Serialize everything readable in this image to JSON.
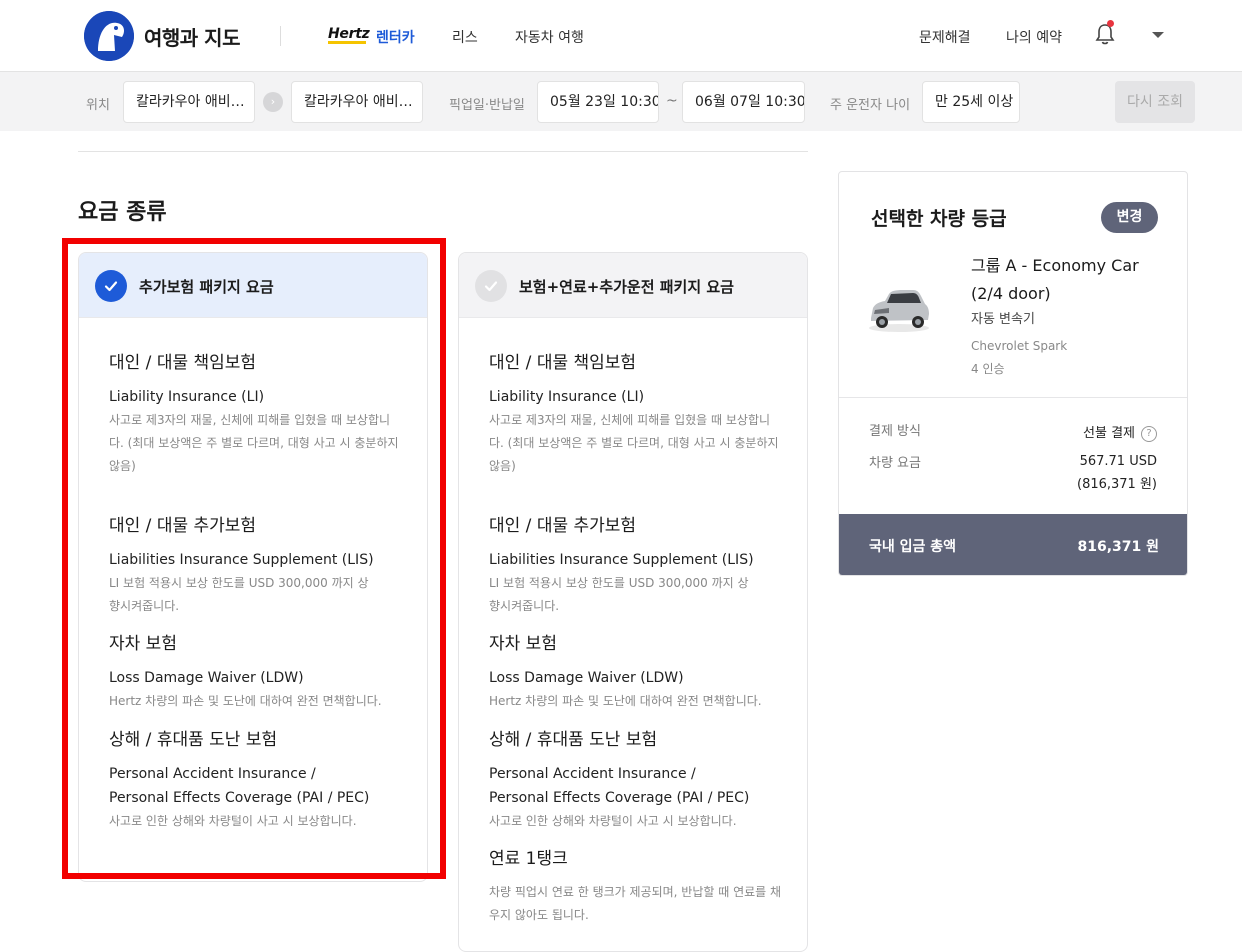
{
  "header": {
    "brand": "여행과 지도",
    "hertz_logo": "Hertz",
    "nav": [
      {
        "label": "렌터카",
        "active": true
      },
      {
        "label": "리스",
        "active": false
      },
      {
        "label": "자동차 여행",
        "active": false
      }
    ],
    "right_links": [
      "문제해결",
      "나의 예약"
    ],
    "icons": {
      "bell": "bell-icon",
      "menu": "chevron-down-icon"
    },
    "accent_color": "#1e5bd8"
  },
  "search": {
    "location_label": "위치",
    "pickup_location": "칼라카우아 애비…",
    "return_location": "칼라카우아 애비…",
    "dates_label": "픽업일·반납일",
    "pickup_date": "05월 23일 10:30",
    "tilde": "~",
    "return_date": "06월 07일 10:30",
    "driver_age_label": "주 운전자 나이",
    "driver_age": "만 25세 이상",
    "search_button": "다시 조회"
  },
  "rates": {
    "section_title": "요금 종류",
    "plans": [
      {
        "title": "추가보험 패키지 요금",
        "selected": true,
        "coverages": [
          {
            "heading": "대인 / 대물 책임보험",
            "english": "Liability Insurance (LI)",
            "desc": "사고로 제3자의 재물, 신체에 피해를 입혔을 때 보상합니다. (최대 보상액은 주 별로 다르며, 대형 사고 시 충분하지 않음)"
          },
          {
            "heading": "대인 / 대물 추가보험",
            "english": "Liabilities Insurance Supplement (LIS)",
            "desc": "LI 보험 적용시 보상 한도를 USD 300,000 까지 상향시켜줍니다."
          },
          {
            "heading": "자차 보험",
            "english": "Loss Damage Waiver (LDW)",
            "desc": "Hertz 차량의 파손 및 도난에 대하여 완전 면책합니다."
          },
          {
            "heading": "상해 / 휴대품 도난 보험",
            "english": "Personal Accident Insurance / Personal Effects Coverage (PAI / PEC)",
            "desc": "사고로 인한 상해와 차량털이 사고 시 보상합니다."
          }
        ]
      },
      {
        "title": "보험+연료+추가운전 패키지 요금",
        "selected": false,
        "coverages": [
          {
            "heading": "대인 / 대물 책임보험",
            "english": "Liability Insurance (LI)",
            "desc": "사고로 제3자의 재물, 신체에 피해를 입혔을 때 보상합니다. (최대 보상액은 주 별로 다르며, 대형 사고 시 충분하지 않음)"
          },
          {
            "heading": "대인 / 대물 추가보험",
            "english": "Liabilities Insurance Supplement (LIS)",
            "desc": "LI 보험 적용시 보상 한도를 USD 300,000 까지 상향시켜줍니다."
          },
          {
            "heading": "자차 보험",
            "english": "Loss Damage Waiver (LDW)",
            "desc": "Hertz 차량의 파손 및 도난에 대하여 완전 면책합니다."
          },
          {
            "heading": "상해 / 휴대품 도난 보험",
            "english": "Personal Accident Insurance / Personal Effects Coverage (PAI / PEC)",
            "desc": "사고로 인한 상해와 차량털이 사고 시 보상합니다."
          },
          {
            "heading": "연료 1탱크",
            "english": "",
            "desc": "차량 픽업시 연료 한 탱크가 제공되며, 반납할 때 연료를 채우지 않아도 됩니다."
          }
        ]
      }
    ]
  },
  "summary": {
    "title": "선택한 차량 등급",
    "change_button": "변경",
    "car_group": "그룹 A - Economy Car (2/4 door)",
    "transmission": "자동 변속기",
    "model": "Chevrolet Spark",
    "seats": "4 인승",
    "payment_method_label": "결제 방식",
    "payment_method": "선불 결제",
    "vehicle_fee_label": "차량 요금",
    "vehicle_fee_usd": "567.71 USD",
    "vehicle_fee_krw": "(816,371 원)",
    "total_label": "국내 입금 총액",
    "total_value": "816,371 원",
    "total_bg_color": "#5f6479"
  },
  "highlight_color": "#f20000"
}
